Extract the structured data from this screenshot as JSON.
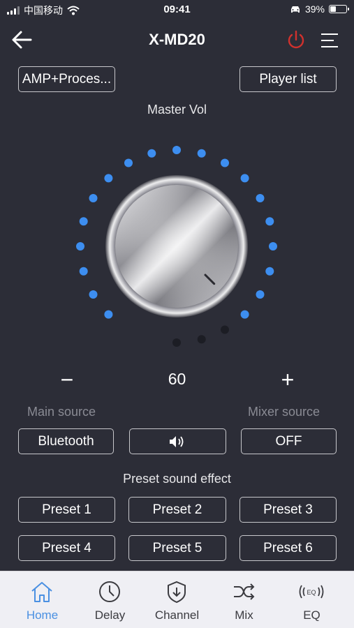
{
  "status_bar": {
    "carrier": "中国移动",
    "time": "09:41",
    "battery": "39%",
    "battery_level": 0.39
  },
  "header": {
    "title": "X-MD20"
  },
  "top_buttons": {
    "mode": "AMP+Proces...",
    "player_list": "Player list"
  },
  "master_vol": {
    "label": "Master Vol",
    "value": "60",
    "minus": "−",
    "plus": "+",
    "indicator_dots_total": 22,
    "indicator_dots_active": 19,
    "active_color": "#3d8ef0",
    "inactive_color": "#1c1d24"
  },
  "sources": {
    "main_label": "Main source",
    "mixer_label": "Mixer source",
    "main_value": "Bluetooth",
    "mixer_value": "OFF"
  },
  "presets": {
    "label": "Preset sound effect",
    "items": [
      "Preset 1",
      "Preset 2",
      "Preset 3",
      "Preset 4",
      "Preset 5",
      "Preset 6"
    ]
  },
  "tabs": [
    {
      "label": "Home",
      "icon": "home-icon",
      "active": true
    },
    {
      "label": "Delay",
      "icon": "clock-icon",
      "active": false
    },
    {
      "label": "Channel",
      "icon": "channel-icon",
      "active": false
    },
    {
      "label": "Mix",
      "icon": "shuffle-icon",
      "active": false
    },
    {
      "label": "EQ",
      "icon": "eq-icon",
      "active": false
    }
  ],
  "colors": {
    "background": "#2c2d37",
    "power": "#d0312d",
    "tab_active": "#4a90e2"
  }
}
